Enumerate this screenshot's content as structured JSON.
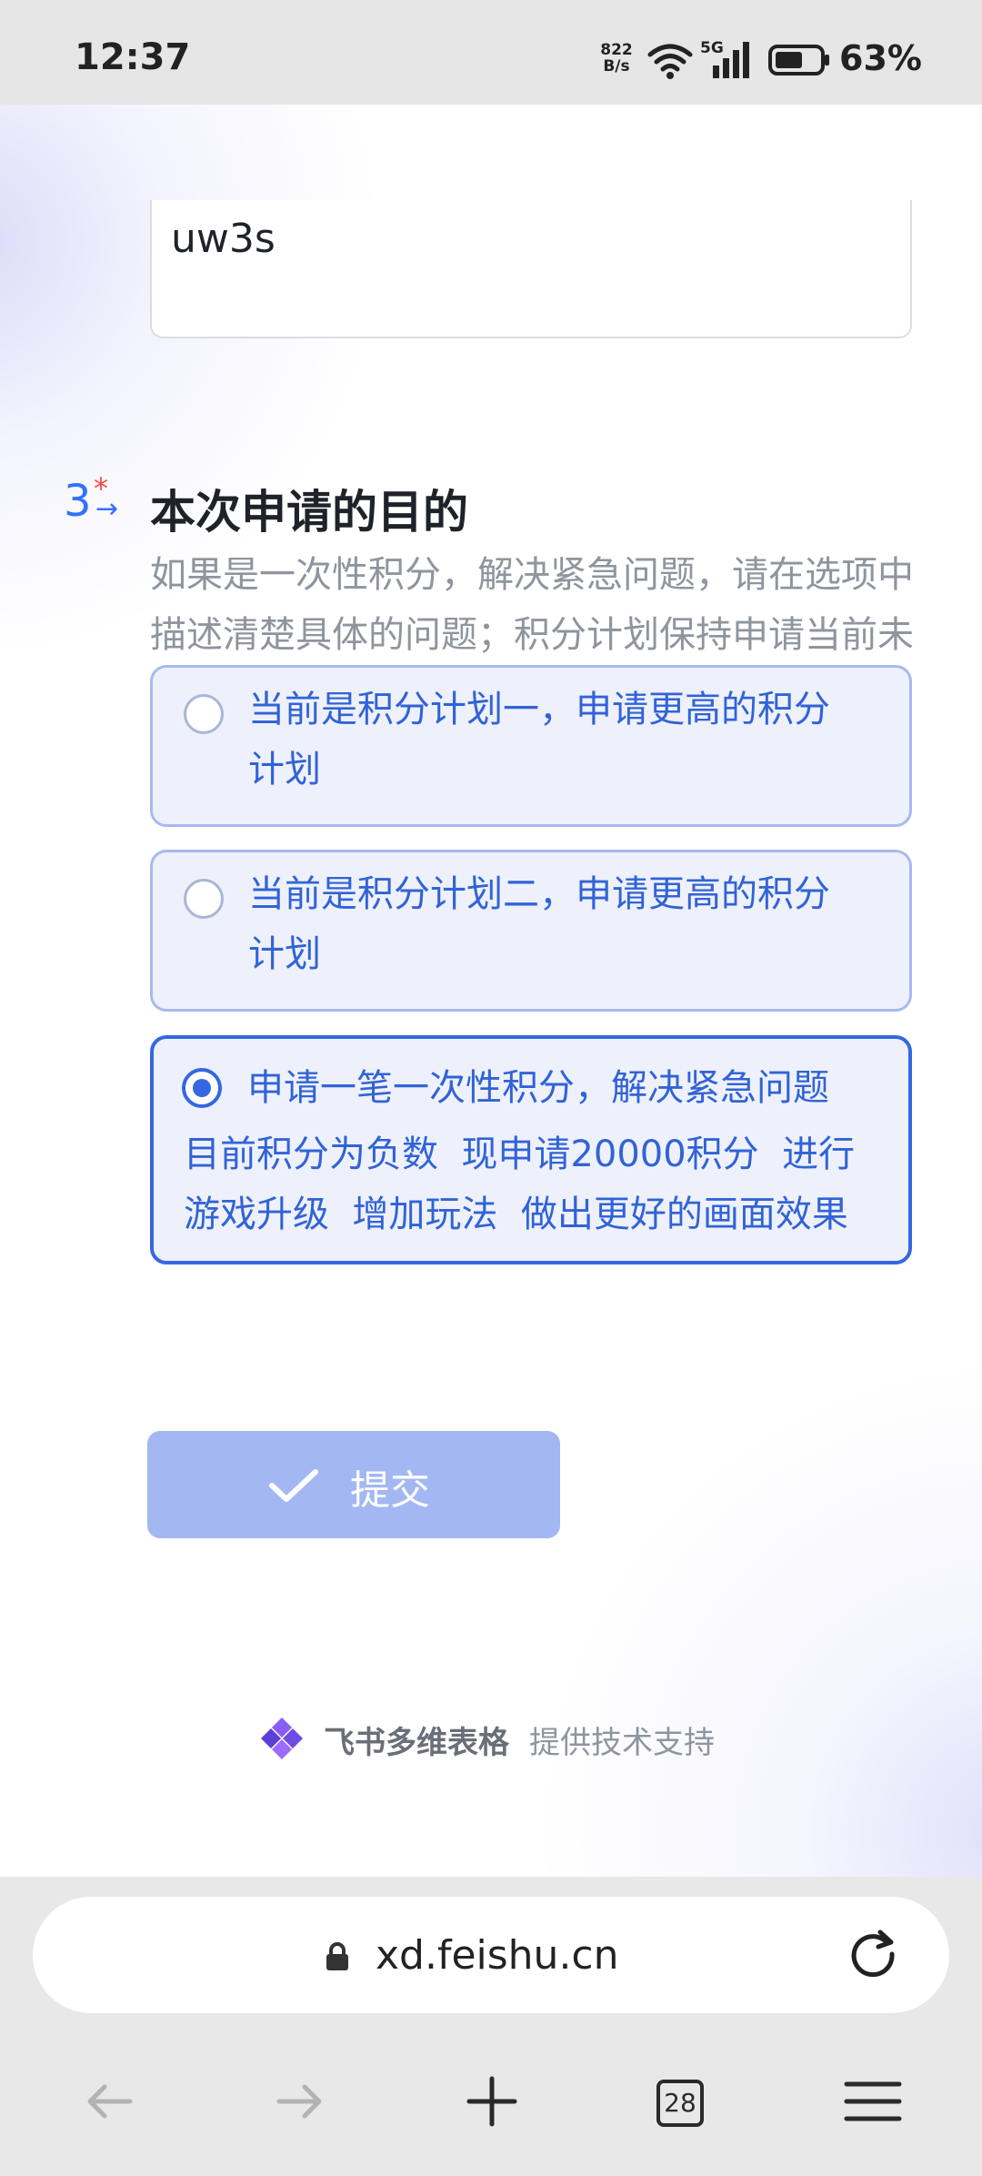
{
  "status_bar": {
    "time": "12:37",
    "net_rate": "822\nB/s",
    "network": "5G",
    "battery_pct": "63%",
    "battery_level": 0.63
  },
  "form": {
    "prev_answer_value": "uw3s",
    "question": {
      "number": "3",
      "required_mark": "*",
      "arrow": "→",
      "title": "本次申请的目的",
      "description": "如果是一次性积分，解决紧急问题，请在选项中描述清楚具体的问题；积分计划保持申请当前未在窗口期，暂时不需要申请",
      "options": [
        {
          "label_line1": "当前是积分计划一，申请更高的积分",
          "label_line2": "计划",
          "selected": false
        },
        {
          "label_line1": "当前是积分计划二，申请更高的积分",
          "label_line2": "计划",
          "selected": false
        },
        {
          "label_line1": "申请一笔一次性积分，解决紧急问题",
          "label_line2": "目前积分为负数  现申请20000积分  进行",
          "label_line3": "游戏升级  增加玩法  做出更好的画面效果",
          "selected": true
        }
      ]
    },
    "submit_label": "提交"
  },
  "footer": {
    "brand": "飞书多维表格",
    "text": "提供技术支持"
  },
  "browser": {
    "url": "xd.feishu.cn",
    "tab_count": "28"
  },
  "colors": {
    "accent": "#3370ff",
    "option_text": "#3163d6",
    "option_bg": "#eef1fc",
    "submit_disabled": "#a3b7f2",
    "required": "#f54a45"
  },
  "icons": [
    "lock-icon",
    "reload-icon",
    "back-icon",
    "forward-icon",
    "new-tab-icon",
    "tabs-icon",
    "menu-icon",
    "check-icon",
    "feishu-logo-icon",
    "wifi-icon",
    "signal-icon",
    "battery-icon"
  ]
}
